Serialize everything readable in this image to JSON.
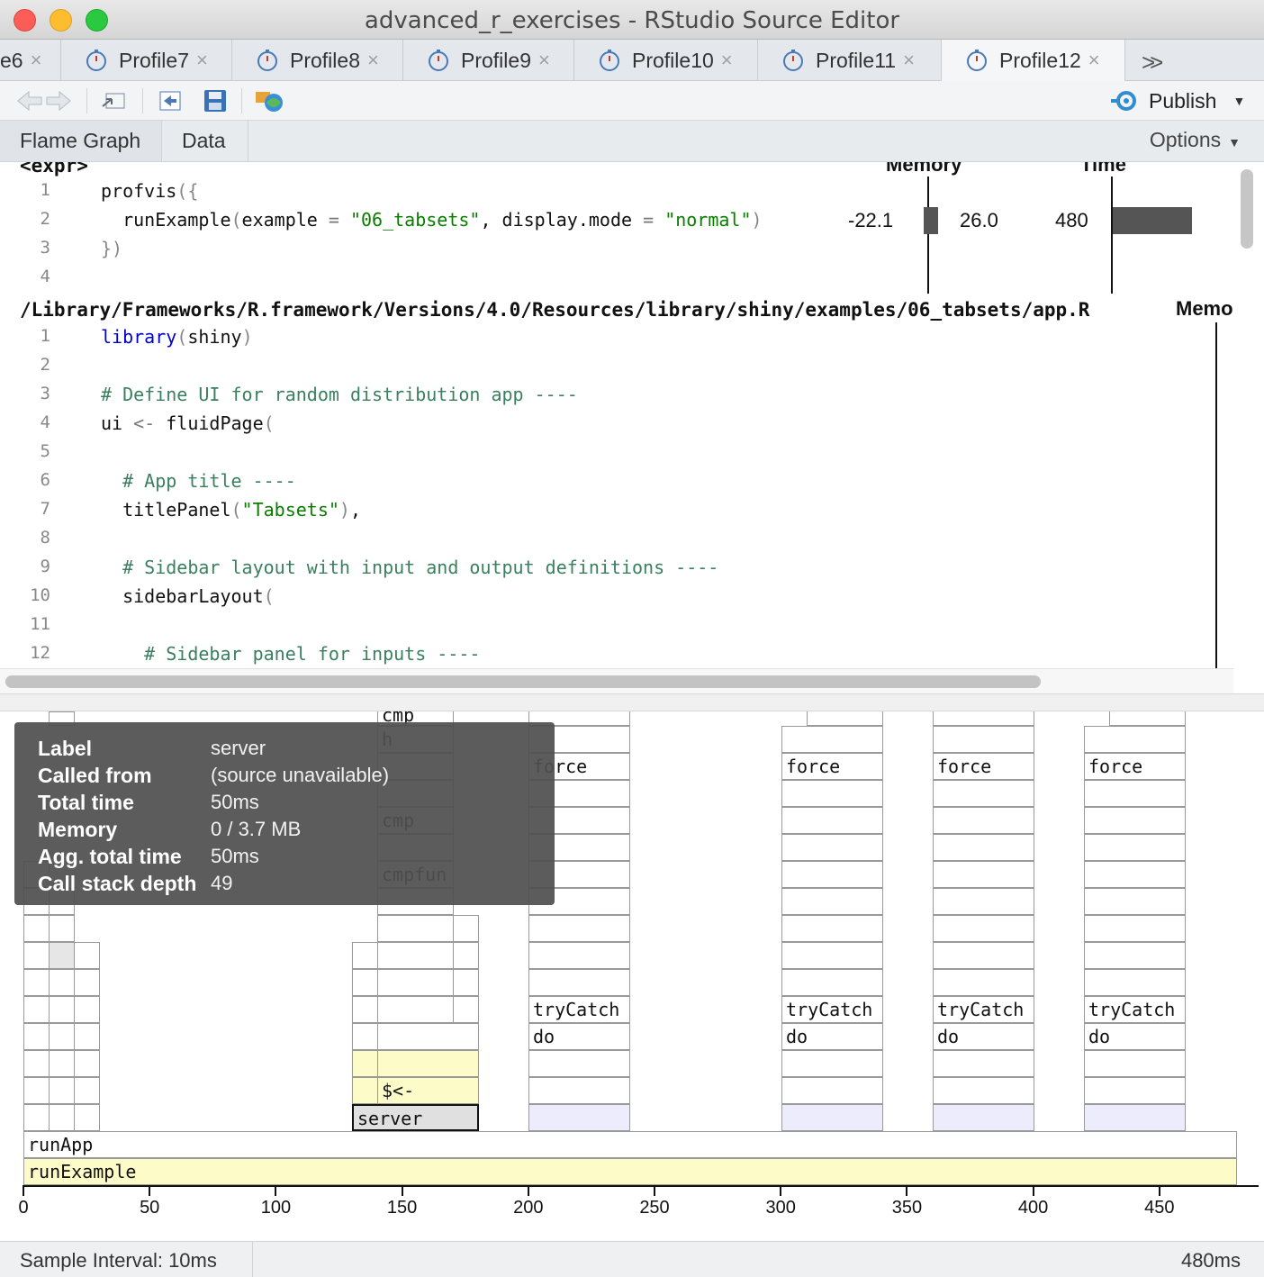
{
  "window": {
    "title": "advanced_r_exercises - RStudio Source Editor"
  },
  "tabs": [
    {
      "label": "e6"
    },
    {
      "label": "Profile7"
    },
    {
      "label": "Profile8"
    },
    {
      "label": "Profile9"
    },
    {
      "label": "Profile10"
    },
    {
      "label": "Profile11"
    },
    {
      "label": "Profile12",
      "active": true
    }
  ],
  "toolbar": {
    "publish_label": "Publish"
  },
  "subtabs": {
    "flame_graph": "Flame Graph",
    "data": "Data",
    "options": "Options"
  },
  "expr_panel": {
    "header": "<expr>",
    "memory_header": "Memory",
    "time_header": "Time",
    "line_numbers": [
      "1",
      "2",
      "3",
      "4"
    ],
    "lines": [
      "profvis({",
      "  runExample(example = \"06_tabsets\", display.mode = \"normal\")",
      "})",
      ""
    ],
    "memory_neg": "-22.1",
    "memory_pos": "26.0",
    "time": "480"
  },
  "file_panel": {
    "path": "/Library/Frameworks/R.framework/Versions/4.0/Resources/library/shiny/examples/06_tabsets/app.R",
    "memory_header": "Memo",
    "line_numbers": [
      "1",
      "2",
      "3",
      "4",
      "5",
      "6",
      "7",
      "8",
      "9",
      "10",
      "11",
      "12"
    ],
    "lines": [
      "library(shiny)",
      "",
      "# Define UI for random distribution app ----",
      "ui <- fluidPage(",
      "",
      "  # App title ----",
      "  titlePanel(\"Tabsets\"),",
      "",
      "  # Sidebar layout with input and output definitions ----",
      "  sidebarLayout(",
      "",
      "    # Sidebar panel for inputs ----"
    ]
  },
  "flame": {
    "labels": {
      "cmp": "cmp",
      "h": "h",
      "cmp2": "cmp",
      "cmpfun": "cmpfun",
      "force": "force",
      "tryCatch": "tryCatch",
      "do": "do",
      "assign": "$<-",
      "server": "server",
      "runApp": "runApp",
      "runExample": "runExample"
    },
    "axis_ticks": [
      "0",
      "50",
      "100",
      "150",
      "200",
      "250",
      "300",
      "350",
      "400",
      "450"
    ],
    "axis_values": [
      0,
      50,
      100,
      150,
      200,
      250,
      300,
      350,
      400,
      450
    ]
  },
  "tooltip": {
    "label_k": "Label",
    "label_v": "server",
    "called_k": "Called from",
    "called_v": "(source unavailable)",
    "total_k": "Total time",
    "total_v": "50ms",
    "memory_k": "Memory",
    "memory_v": "0 / 3.7 MB",
    "agg_k": "Agg. total time",
    "agg_v": "50ms",
    "depth_k": "Call stack depth",
    "depth_v": "49"
  },
  "status": {
    "sample_interval": "Sample Interval: 10ms",
    "total": "480ms"
  },
  "colors": {
    "bar": "#555555",
    "yellow_cell": "#fdfcc8",
    "lavender_cell": "#ececfc"
  }
}
